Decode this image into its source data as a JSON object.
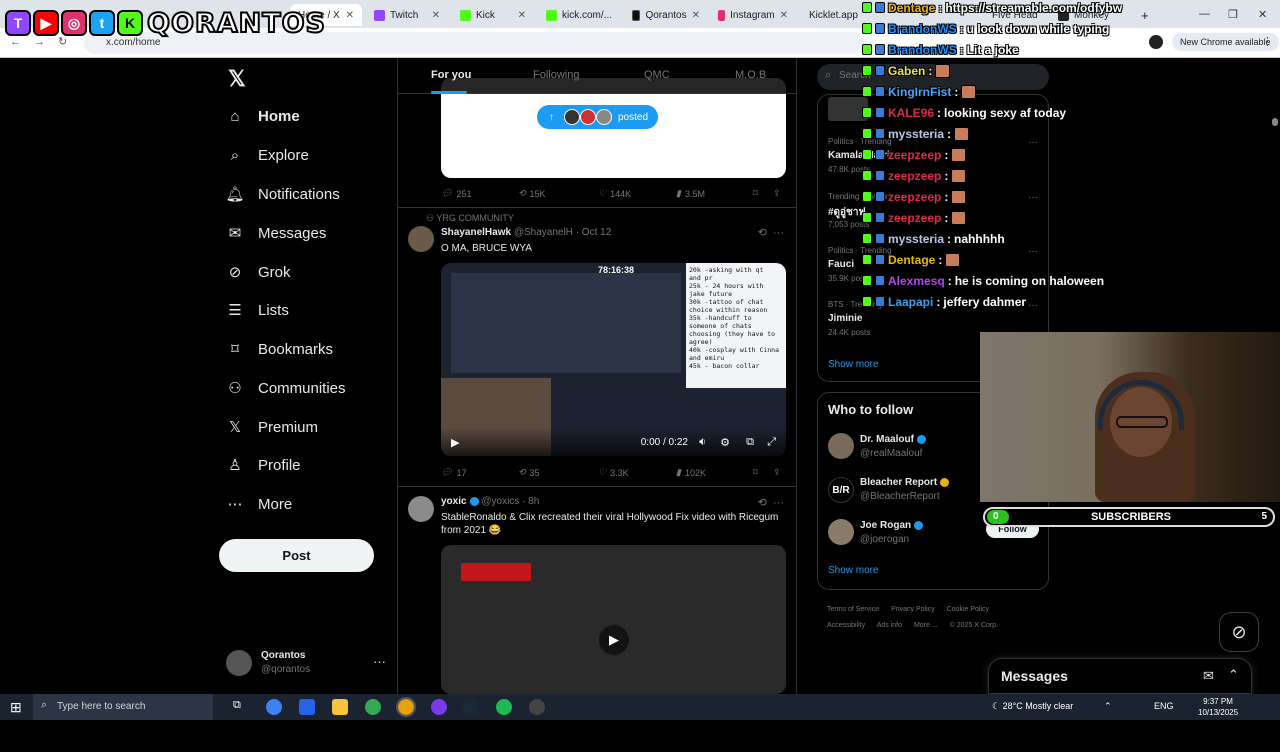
{
  "browser": {
    "tabs": [
      {
        "label": "Home / X",
        "icon_color": "#000000",
        "active": true
      },
      {
        "label": "Twitch",
        "icon_color": "#9146ff"
      },
      {
        "label": "Kick",
        "icon_color": "#53fc18"
      },
      {
        "label": "kick.com/...",
        "icon_color": "#53fc18"
      },
      {
        "label": "Qorantos",
        "icon_color": "#000000"
      },
      {
        "label": "Instagram",
        "icon_color": "#e1306c"
      },
      {
        "label": "Kicklet.app",
        "icon_color": "#53fc18"
      },
      {
        "label": "The best",
        "icon_color": "#888888"
      },
      {
        "label": "Five Head",
        "icon_color": "#888888"
      },
      {
        "label": "Monkey",
        "icon_color": "#888888"
      }
    ],
    "url": "x.com/home",
    "new_chrome_label": "New Chrome available",
    "window_controls": [
      "—",
      "❐",
      "✕"
    ]
  },
  "overlay": {
    "brand": "QORANTOS",
    "socials": [
      {
        "letter": "T",
        "color": "#9146ff"
      },
      {
        "letter": "▶",
        "color": "#ff0000"
      },
      {
        "letter": "◎",
        "color": "#e1306c"
      },
      {
        "letter": "t",
        "color": "#1da1f2"
      },
      {
        "letter": "K",
        "color": "#53fc18"
      }
    ]
  },
  "nav": {
    "logo": "𝕏",
    "items": [
      {
        "label": "Home",
        "icon": "⌂",
        "icon_name": "home-icon"
      },
      {
        "label": "Explore",
        "icon": "⌕",
        "icon_name": "search-icon"
      },
      {
        "label": "Notifications",
        "icon": "🔔︎",
        "icon_name": "bell-icon"
      },
      {
        "label": "Messages",
        "icon": "✉",
        "icon_name": "mail-icon"
      },
      {
        "label": "Grok",
        "icon": "⊘",
        "icon_name": "grok-icon"
      },
      {
        "label": "Lists",
        "icon": "☰",
        "icon_name": "list-icon"
      },
      {
        "label": "Bookmarks",
        "icon": "⌑",
        "icon_name": "bookmark-icon"
      },
      {
        "label": "Communities",
        "icon": "⚇",
        "icon_name": "communities-icon"
      },
      {
        "label": "Premium",
        "icon": "𝕏",
        "icon_name": "premium-icon"
      },
      {
        "label": "Profile",
        "icon": "♙",
        "icon_name": "profile-icon"
      },
      {
        "label": "More",
        "icon": "⋯",
        "icon_name": "more-icon"
      }
    ],
    "post_label": "Post",
    "account": {
      "name": "Qorantos",
      "handle": "@qorantos"
    }
  },
  "feed": {
    "tabs": [
      "For you",
      "Following",
      "QMC",
      "M.O.B"
    ],
    "posted_label": "posted",
    "tweet0_actions": {
      "replies": "251",
      "reposts": "15K",
      "likes": "144K",
      "views": "3.5M"
    },
    "tweet1": {
      "context": "YRG COMMUNITY",
      "name": "ShayanelHawk",
      "handle": "@ShayanelH",
      "time": "· Oct 12",
      "text": "O MA, BRUCE WYA",
      "video_time": "0:00 / 0:22",
      "timer": "78:16:38",
      "note_text": "20k -asking with qt\nand pr\n25k - 24 hours with\njake future\n30k -tattoo of chat\nchoice within reason\n35k -handcuff to\nsomeone of chats\nchoosing (they have to\nagree)\n40k -cosplay with Cinna\nand emiru\n45k - bacon collar",
      "actions": {
        "replies": "17",
        "reposts": "35",
        "likes": "3.3K",
        "views": "102K"
      }
    },
    "tweet2": {
      "name": "yoxic",
      "handle": "@yoxics",
      "time": "· 8h",
      "text": "StableRonaldo & Clix recreated their viral Hollywood Fix video with Ricegum from 2021 😂"
    }
  },
  "right": {
    "search_placeholder": "Search",
    "trends": [
      {
        "meta": "Politics · Trending",
        "name": "Kamala Harris",
        "posts": "47.8K posts"
      },
      {
        "meta": "Trending in Malaysia",
        "name": "#ดูอู่ชาฟ",
        "posts": "7,053 posts"
      },
      {
        "meta": "Politics · Trending",
        "name": "Fauci",
        "posts": "35.9K posts"
      },
      {
        "meta": "BTS · Trending",
        "name": "Jiminie",
        "posts": "24.4K posts"
      }
    ],
    "show_more": "Show more",
    "who_to_follow_title": "Who to follow",
    "follow_suggestions": [
      {
        "name": "Dr. Maalouf",
        "handle": "@realMaalouf",
        "badge": "blue"
      },
      {
        "name": "Bleacher Report",
        "handle": "@BleacherReport",
        "badge": "gold"
      },
      {
        "name": "Joe Rogan",
        "handle": "@joerogan",
        "badge": "blue"
      }
    ],
    "follow_label": "Follow",
    "footer_links": [
      "Terms of Service",
      "Privacy Policy",
      "Cookie Policy",
      "Accessibility",
      "Ads info",
      "More ...",
      "© 2025 X Corp."
    ],
    "messages_title": "Messages"
  },
  "chat": {
    "lines": [
      {
        "user": "Dentage",
        "msg": "https://streamable.com/odfybw",
        "color": "#e8b21e"
      },
      {
        "user": "BrandonWS",
        "msg": "u look down while typing",
        "color": "#1e90ff"
      },
      {
        "user": "BrandonWS",
        "msg": "Lit a joke",
        "color": "#1e90ff"
      },
      {
        "user": "Gaben",
        "msg": "",
        "color": "#e8e34a",
        "emote": true
      },
      {
        "user": "KingIrnFist",
        "msg": "",
        "color": "#4aa3ff",
        "emote": true
      },
      {
        "user": "KALE96",
        "msg": "looking sexy af today",
        "color": "#e0294a"
      },
      {
        "user": "myssteria",
        "msg": "",
        "color": "#b9c7e6",
        "emote": true
      },
      {
        "user": "zeepzeep",
        "msg": "",
        "color": "#e0294a",
        "emote": true
      },
      {
        "user": "zeepzeep",
        "msg": "",
        "color": "#e0294a",
        "emote": true
      },
      {
        "user": "zeepzeep",
        "msg": "",
        "color": "#e0294a",
        "emote": true
      },
      {
        "user": "zeepzeep",
        "msg": "",
        "color": "#e0294a",
        "emote": true
      },
      {
        "user": "myssteria",
        "msg": "nahhhhh",
        "color": "#b9c7e6"
      },
      {
        "user": "Dentage",
        "msg": "",
        "color": "#e8b21e",
        "emote": true
      },
      {
        "user": "Alexmesq",
        "msg": "he is coming on haloween",
        "color": "#b04ae8"
      },
      {
        "user": "Laapapi",
        "msg": "jeffery dahmer",
        "color": "#3aa0e8"
      }
    ]
  },
  "subscribers": {
    "label": "SUBSCRIBERS",
    "current": "0",
    "goal": "5",
    "progress": 0.0
  },
  "taskbar": {
    "search_placeholder": "Type here to search",
    "weather": "28°C  Mostly clear",
    "lang": "ENG",
    "time": "9:37 PM",
    "date": "10/13/2025"
  }
}
